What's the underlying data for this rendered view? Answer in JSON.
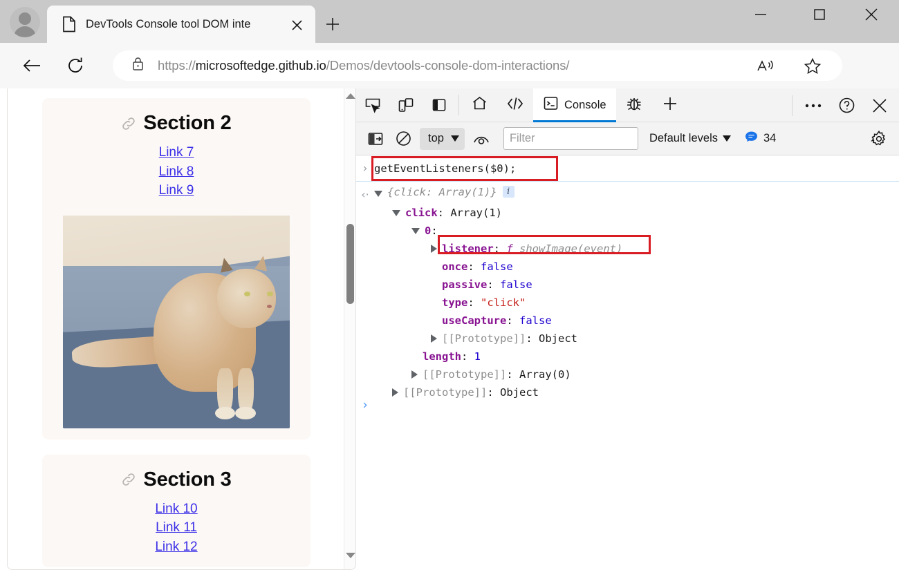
{
  "browser": {
    "tab": {
      "title": "DevTools Console tool DOM inte",
      "favicon": "page-icon",
      "close_label": "✕"
    },
    "new_tab_label": "+",
    "window_controls": {
      "minimize": "‒",
      "maximize": "□",
      "close": "✕"
    },
    "nav": {
      "back": "←",
      "reload": "↻"
    },
    "omnibox": {
      "scheme": "https://",
      "host": "microsoftedge.github.io",
      "path": "/Demos/devtools-console-dom-interactions/",
      "lock_icon": "lock-icon",
      "read_aloud_icon": "read-aloud-icon",
      "favorite_icon": "star-icon"
    },
    "more_label": "⋯"
  },
  "page": {
    "sections": [
      {
        "title": "Section 2",
        "anchor_icon": "link-icon",
        "links": [
          "Link 7",
          "Link 8",
          "Link 9"
        ],
        "image": {
          "alt": "cat-photo",
          "name": "cat-photo"
        }
      },
      {
        "title": "Section 3",
        "anchor_icon": "link-icon",
        "links": [
          "Link 10",
          "Link 11",
          "Link 12"
        ]
      }
    ],
    "scrollbar": {
      "up_icon": "scroll-up-arrow",
      "down_icon": "scroll-down-arrow"
    }
  },
  "devtools": {
    "toolbar_icons": [
      {
        "name": "inspect-element-icon"
      },
      {
        "name": "device-emulation-icon"
      },
      {
        "name": "dock-side-icon"
      }
    ],
    "tabs": [
      {
        "name": "welcome-tab",
        "icon": "home-icon",
        "label": "",
        "active": false
      },
      {
        "name": "elements-tab",
        "icon": "code-icon",
        "label": "",
        "active": false
      },
      {
        "name": "console-tab",
        "icon": "console-icon",
        "label": "Console",
        "active": true
      },
      {
        "name": "issues-tab",
        "icon": "bug-icon",
        "label": "",
        "active": false
      },
      {
        "name": "more-tools-tab",
        "icon": "plus-icon",
        "label": "",
        "active": false
      }
    ],
    "right_controls": [
      {
        "name": "more-options-button",
        "label": "⋯"
      },
      {
        "name": "help-button",
        "label": "?"
      },
      {
        "name": "close-devtools-button",
        "label": "✕"
      }
    ],
    "filterbar": {
      "sidebar_icon": "console-sidebar-icon",
      "clear_icon": "clear-console-icon",
      "context": "top",
      "live_expression_icon": "eye-icon",
      "filter_placeholder": "Filter",
      "filter_value": "",
      "levels_label": "Default levels",
      "message_count": "34",
      "message_icon": "speech-bubble-icon",
      "settings_icon": "gear-icon"
    },
    "console": {
      "input_prompt": "›",
      "input_text": "getEventListeners($0);",
      "return_arrow": "‹·",
      "bottom_prompt": "›",
      "result_preview": "{click: Array(1)}",
      "info_badge": "i",
      "tree": [
        {
          "indent": 1,
          "tri": "open",
          "key": "click",
          "key_style": "prop",
          "sep": ": ",
          "value": "Array(1)",
          "value_style": "plain"
        },
        {
          "indent": 2,
          "tri": "open",
          "key": "0",
          "key_style": "prop",
          "sep": ":",
          "value": "",
          "value_style": "plain"
        },
        {
          "indent": 3,
          "tri": "closed",
          "key": "listener",
          "key_style": "prop",
          "sep": ": ",
          "value": "showImage(event)",
          "value_style": "fn"
        },
        {
          "indent": 3,
          "tri": "none",
          "key": "once",
          "key_style": "prop",
          "sep": ": ",
          "value": "false",
          "value_style": "bool"
        },
        {
          "indent": 3,
          "tri": "none",
          "key": "passive",
          "key_style": "prop",
          "sep": ": ",
          "value": "false",
          "value_style": "bool"
        },
        {
          "indent": 3,
          "tri": "none",
          "key": "type",
          "key_style": "prop",
          "sep": ": ",
          "value": "\"click\"",
          "value_style": "str"
        },
        {
          "indent": 3,
          "tri": "none",
          "key": "useCapture",
          "key_style": "prop",
          "sep": ": ",
          "value": "false",
          "value_style": "bool"
        },
        {
          "indent": 3,
          "tri": "closed",
          "key": "[[Prototype]]",
          "key_style": "grey",
          "sep": ": ",
          "value": "Object",
          "value_style": "plain"
        },
        {
          "indent": 2,
          "tri": "none",
          "key": "length",
          "key_style": "prop",
          "sep": ": ",
          "value": "1",
          "value_style": "num"
        },
        {
          "indent": 2,
          "tri": "closed",
          "key": "[[Prototype]]",
          "key_style": "grey",
          "sep": ": ",
          "value": "Array(0)",
          "value_style": "plain"
        },
        {
          "indent": 1,
          "tri": "closed",
          "key": "[[Prototype]]",
          "key_style": "grey",
          "sep": ": ",
          "value": "Object",
          "value_style": "plain"
        }
      ]
    }
  },
  "colors": {
    "accent": "#0078d4",
    "highlight_box": "#d91c23",
    "link": "#3a2ee8",
    "prop_key": "#881391",
    "value_blue": "#1c00cf",
    "string_red": "#c41a16",
    "chrome_bg": "#c9c9c9",
    "toolbar_bg": "#f3f3f3",
    "card_bg": "#fcf8f5"
  }
}
